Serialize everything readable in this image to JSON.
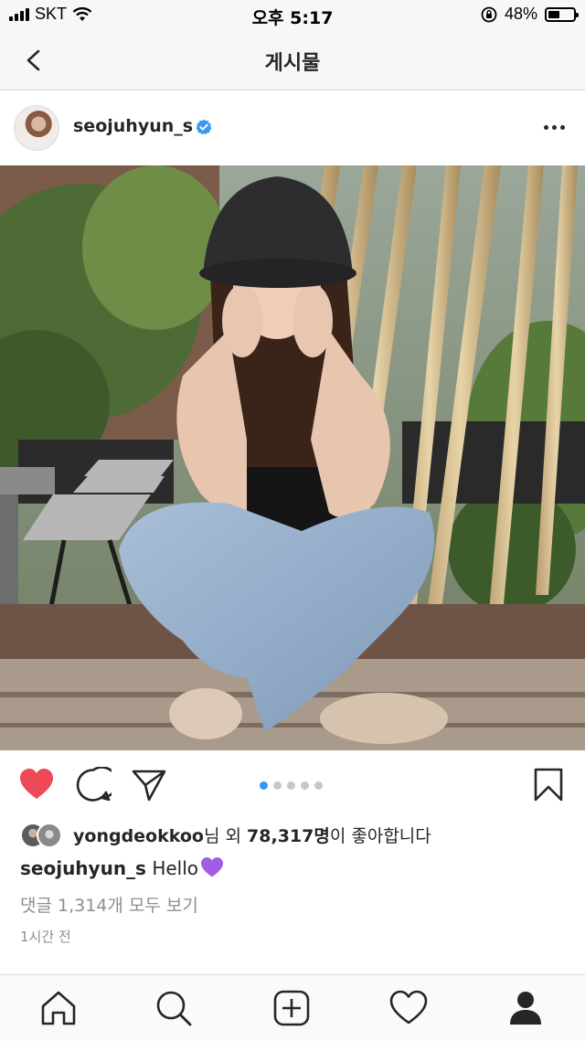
{
  "status_bar": {
    "carrier": "SKT",
    "time": "오후 5:17",
    "battery": "48%",
    "battery_level": 0.48,
    "icons": [
      "signal-bars-icon",
      "wifi-icon",
      "orientation-lock-icon",
      "battery-icon"
    ]
  },
  "nav": {
    "title": "게시물",
    "back_icon": "chevron-left-icon"
  },
  "post": {
    "username": "seojuhyun_s",
    "verified_icon": "verified-badge-icon",
    "more_icon": "more-options-icon",
    "photo_icon": "post-photo",
    "carousel": {
      "count": 5,
      "active": 1
    },
    "actions": {
      "like_icon": "heart-filled-icon",
      "comment_icon": "comment-icon",
      "share_icon": "direct-share-icon",
      "save_icon": "bookmark-icon"
    },
    "likes": {
      "liker": "yongdeokkoo",
      "liker_suffix": "님 외 ",
      "count": "78,317명",
      "count_suffix": "이 좋아합니다"
    },
    "caption": {
      "username": "seojuhyun_s",
      "text": "Hello",
      "emoji_icon": "purple-heart-icon"
    },
    "comments_link": "댓글 1,314개 모두 보기",
    "time_ago": "1시간 전"
  },
  "tab_bar": {
    "items": [
      "home-icon",
      "search-icon",
      "new-post-icon",
      "activity-heart-icon",
      "profile-icon"
    ]
  },
  "colors": {
    "like_red": "#ed4956",
    "link_blue": "#3897f0",
    "text_primary": "#262626",
    "text_secondary": "#8e8e8e",
    "purple_heart": "#a25ce6"
  }
}
